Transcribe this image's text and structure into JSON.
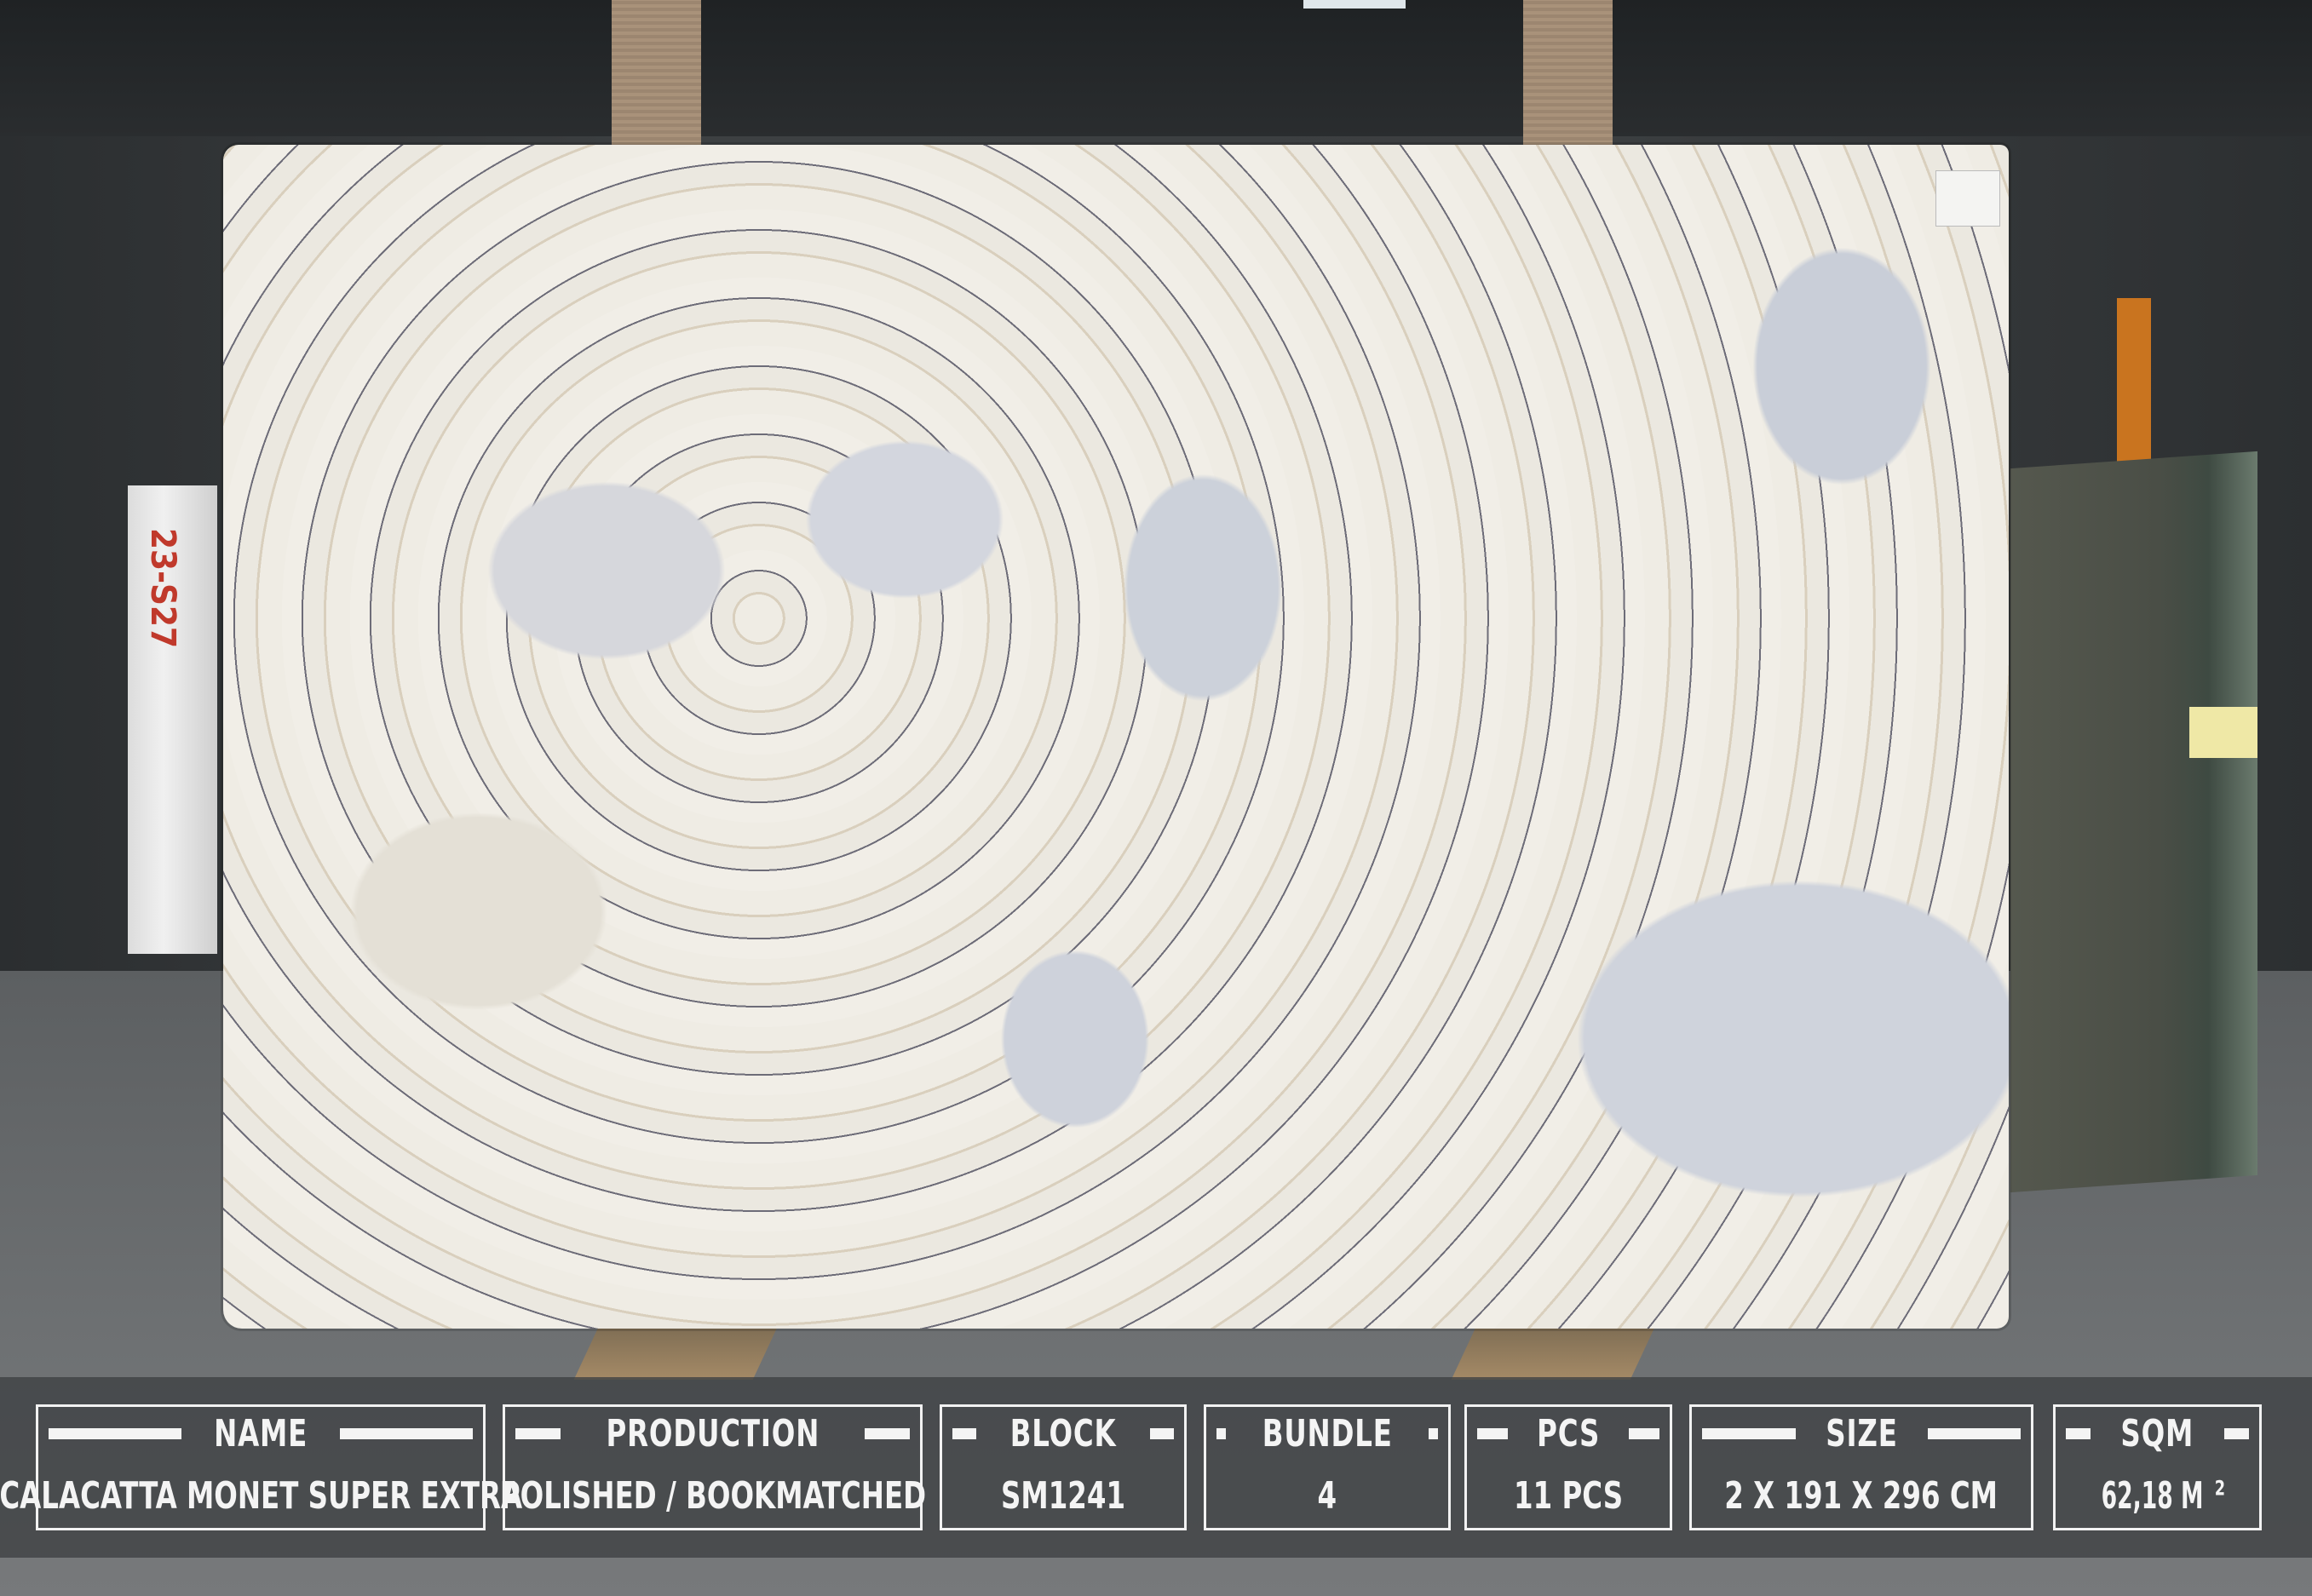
{
  "info_bar": {
    "fields": [
      {
        "label": "NAME",
        "value": "CALACATTA MONET SUPER EXTRA"
      },
      {
        "label": "PRODUCTION",
        "value": "POLISHED /  BOOKMATCHED"
      },
      {
        "label": "BLOCK",
        "value": "SM1241"
      },
      {
        "label": "BUNDLE",
        "value": "4"
      },
      {
        "label": "PCS",
        "value": "11 PCS"
      },
      {
        "label": "SIZE",
        "value": "2 X 191 X  296 CM"
      },
      {
        "label": "SQM",
        "value": "62,18 M",
        "unit_superscript": "2"
      }
    ]
  },
  "rack_marking": "23-S27",
  "colors": {
    "bar_text": "#f4f4f4",
    "bar_background": "#3e4042"
  }
}
